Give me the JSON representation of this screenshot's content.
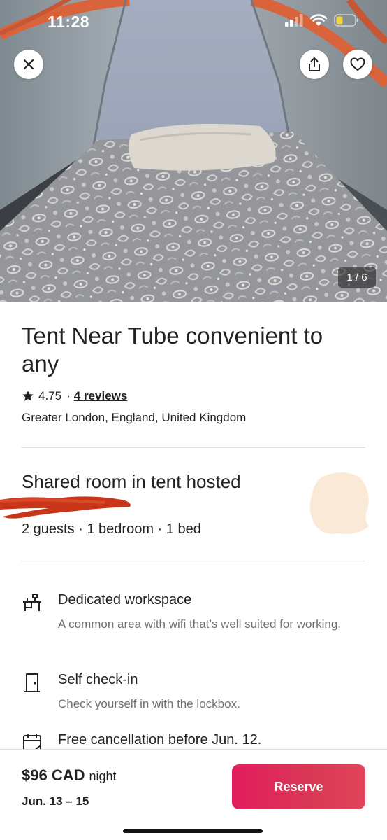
{
  "status_bar": {
    "time": "11:28",
    "icons": [
      "signal-icon",
      "wifi-icon",
      "battery-icon"
    ],
    "battery_color": "#f5d33a"
  },
  "hero": {
    "photo_counter": "1 / 6",
    "buttons": [
      "close-icon",
      "share-icon",
      "heart-icon"
    ]
  },
  "listing": {
    "title": "Tent Near Tube convenient to any",
    "rating": "4.75",
    "separator": "·",
    "reviews_link": "4 reviews",
    "location": "Greater London, England, United Kingdom",
    "room_type": "Shared room in tent hosted",
    "capacity": "2 guests · 1 bedroom · 1 bed"
  },
  "amenities": [
    {
      "icon": "desk-icon",
      "title": "Dedicated workspace",
      "description": "A common area with wifi that’s well suited for working."
    },
    {
      "icon": "door-icon",
      "title": "Self check-in",
      "description": "Check yourself in with the lockbox."
    },
    {
      "icon": "calendar-icon",
      "title": "Free cancellation before Jun. 12.",
      "description": ""
    }
  ],
  "booking": {
    "price": "$96 CAD",
    "per_night": "night",
    "dates": "Jun. 13 – 15",
    "reserve_label": "Reserve"
  },
  "colors": {
    "brand_accent": "#e31c5f",
    "text_primary": "#222222",
    "text_secondary": "#717171",
    "divider": "#dddddd",
    "redaction_mark": "#c93518",
    "tent_trim": "#d9643c"
  }
}
